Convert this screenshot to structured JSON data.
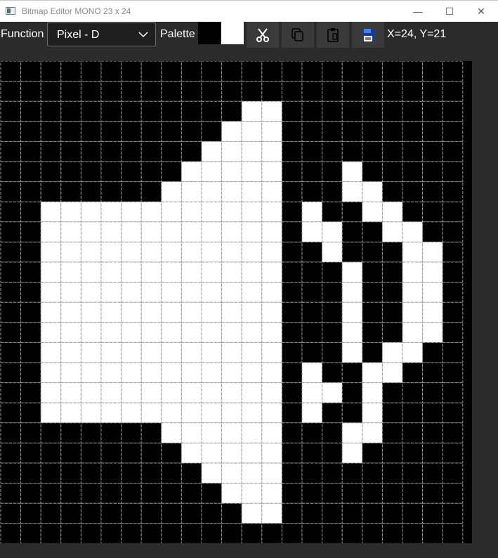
{
  "window": {
    "title": "Bitmap Editor MONO 23 x 24",
    "minimize_glyph": "—",
    "maximize_glyph": "☐",
    "close_glyph": "✕"
  },
  "toolbar": {
    "function_label": "Function",
    "function_value": "Pixel - D",
    "palette_label": "Palette",
    "palette_colors": [
      "#000000",
      "#ffffff"
    ],
    "buttons": [
      {
        "name": "cut-button",
        "icon": "scissors-icon"
      },
      {
        "name": "copy-button",
        "icon": "copy-icon"
      },
      {
        "name": "paste-button",
        "icon": "clipboard-icon"
      },
      {
        "name": "save-button",
        "icon": "floppy-disk-icon"
      }
    ],
    "coords": "X=24, Y=21"
  },
  "bitmap": {
    "width": 23,
    "height": 24,
    "on_color": "#ffffff",
    "off_color": "#000000",
    "grid_color": "#9a9a9a",
    "rows": [
      "00000000000000000000000",
      "00000000000000000000000",
      "00000000000011000000000",
      "00000000000111000000000",
      "00000000001111000000000",
      "00000000011111000100000",
      "00000000111111000110000",
      "00111111111111010011000",
      "00111111111111011001100",
      "00111111111111001000110",
      "00111111111111000100110",
      "00111111111111000100110",
      "00111111111111000100110",
      "00111111111111000100110",
      "00111111111111000101100",
      "00111111111111010011000",
      "00111111111111011010000",
      "00111111111111010010000",
      "00000000111111000110000",
      "00000000011111000100000",
      "00000000001111000000000",
      "00000000000111000000000",
      "00000000000011000000000",
      "00000000000000000000000"
    ]
  }
}
